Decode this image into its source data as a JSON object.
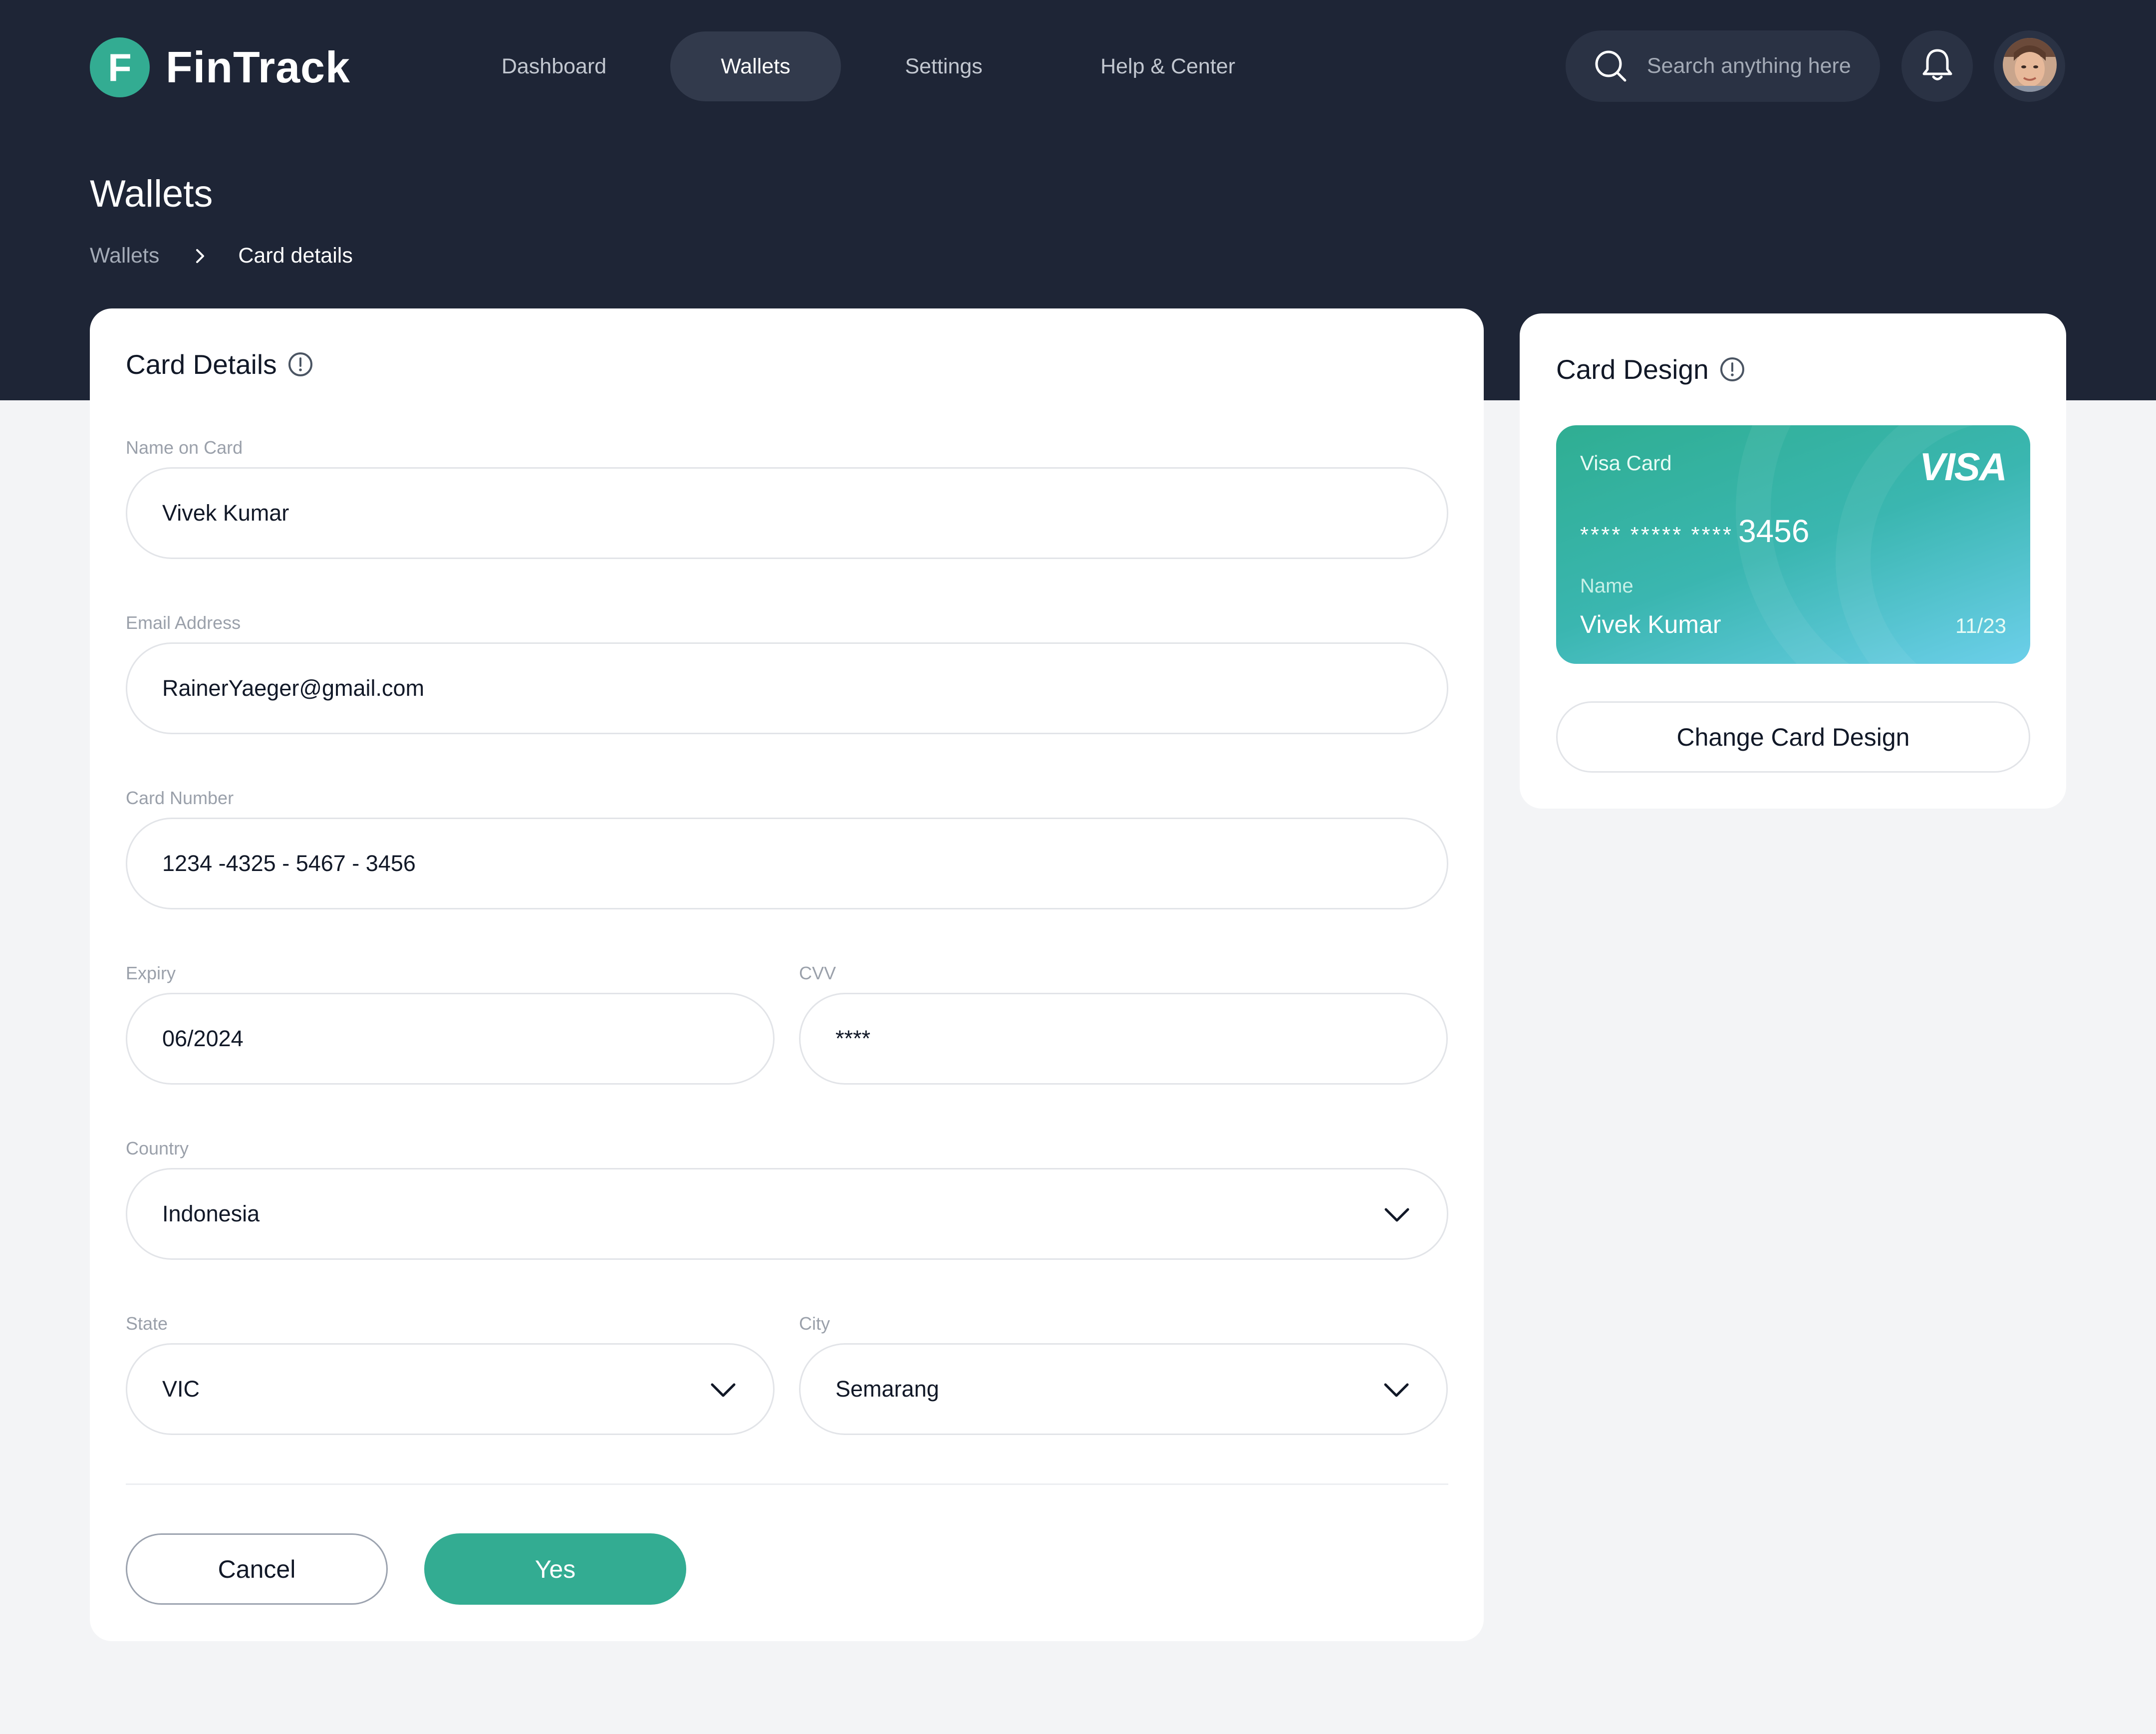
{
  "app": {
    "logo_letter": "F",
    "name": "FinTrack",
    "brand_color": "#33ac92",
    "header_bg": "#1e2536"
  },
  "nav": {
    "items": [
      {
        "label": "Dashboard",
        "active": false
      },
      {
        "label": "Wallets",
        "active": true
      },
      {
        "label": "Settings",
        "active": false
      },
      {
        "label": "Help & Center",
        "active": false
      }
    ]
  },
  "search": {
    "placeholder": "Search anything here",
    "icon": "search-icon"
  },
  "header_icons": {
    "notifications": "bell-icon",
    "profile": "avatar"
  },
  "page": {
    "title": "Wallets",
    "breadcrumb": [
      "Wallets",
      "Card details"
    ]
  },
  "card_details": {
    "title": "Card Details",
    "fields": {
      "name_on_card": {
        "label": "Name on Card",
        "value": "Vivek Kumar"
      },
      "email": {
        "label": "Email Address",
        "value": "RainerYaeger@gmail.com"
      },
      "card_number": {
        "label": "Card Number",
        "value": "1234 -4325 - 5467 - 3456"
      },
      "expiry": {
        "label": "Expiry",
        "value": "06/2024"
      },
      "cvv": {
        "label": "CVV",
        "value": "****"
      },
      "country": {
        "label": "Country",
        "value": "Indonesia"
      },
      "state": {
        "label": "State",
        "value": "VIC"
      },
      "city": {
        "label": "City",
        "value": "Semarang"
      }
    },
    "cancel_label": "Cancel",
    "confirm_label": "Yes"
  },
  "card_design": {
    "title": "Card Design",
    "card": {
      "type": "Visa Card",
      "brand": "VISA",
      "masked": "**** ***** ****",
      "last4": "3456",
      "name_label": "Name",
      "name": "Vivek Kumar",
      "expiry": "11/23"
    },
    "change_label": "Change Card Design"
  }
}
